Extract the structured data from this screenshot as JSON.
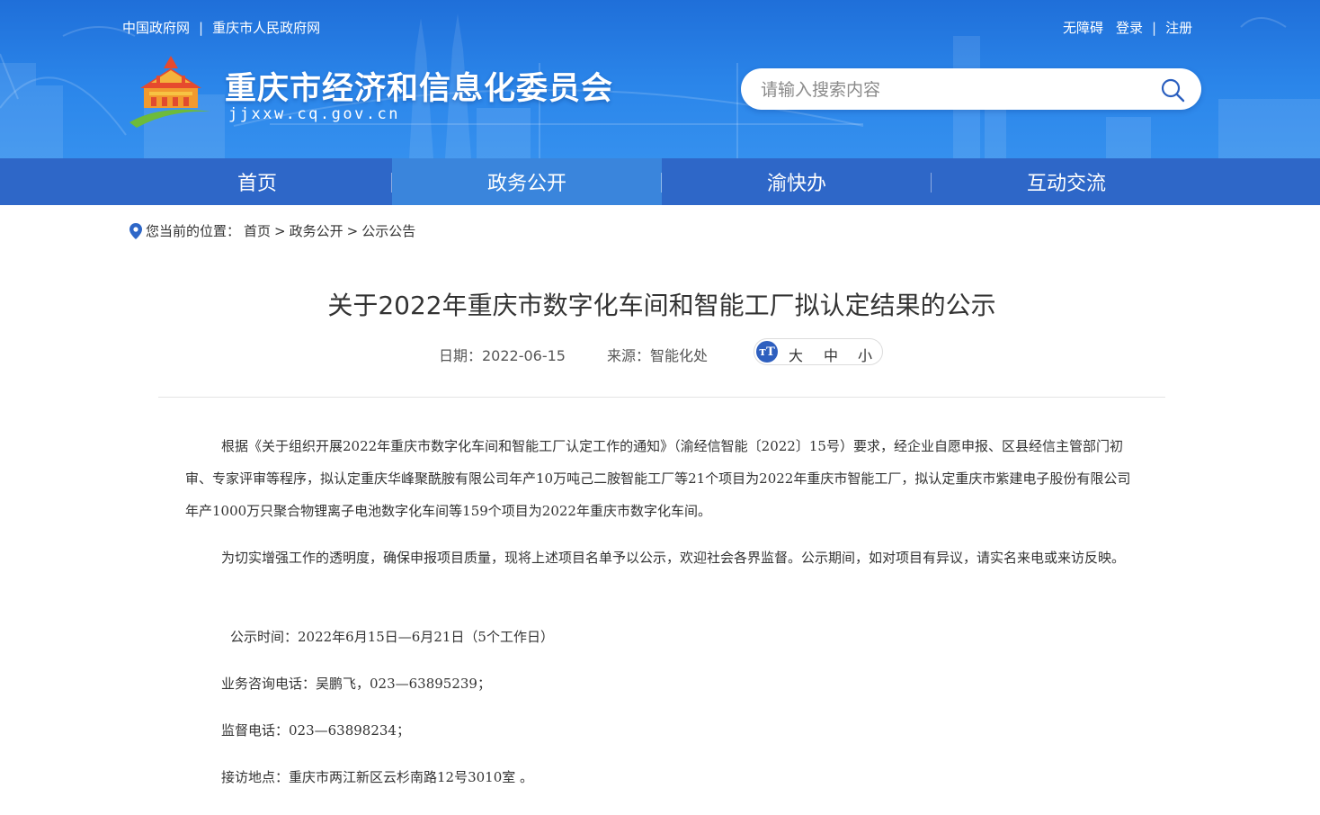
{
  "top_links_left": [
    "中国政府网",
    "重庆市人民政府网"
  ],
  "top_links_right": [
    "无障碍",
    "登录",
    "注册"
  ],
  "site": {
    "title": "重庆市经济和信息化委员会",
    "domain": "jjxxw.cq.gov.cn"
  },
  "search": {
    "placeholder": "请输入搜索内容"
  },
  "nav": [
    "首页",
    "政务公开",
    "渝快办",
    "互动交流"
  ],
  "breadcrumb": {
    "label": "您当前的位置：",
    "items": [
      "首页",
      "政务公开",
      "公示公告"
    ],
    "separator": ">"
  },
  "article": {
    "title": "关于2022年重庆市数字化车间和智能工厂拟认定结果的公示",
    "date": "日期：2022-06-15",
    "source": "来源：智能化处",
    "font_size_options": [
      "大",
      "中",
      "小"
    ],
    "paragraphs": [
      "根据《关于组织开展2022年重庆市数字化车间和智能工厂认定工作的通知》（渝经信智能〔2022〕15号）要求，经企业自愿申报、区县经信主管部门初审、专家评审等程序，拟认定重庆华峰聚酰胺有限公司年产10万吨己二胺智能工厂等21个项目为2022年重庆市智能工厂，拟认定重庆市紫建电子股份有限公司年产1000万只聚合物锂离子电池数字化车间等159个项目为2022年重庆市数字化车间。",
      "为切实增强工作的透明度，确保申报项目质量，现将上述项目名单予以公示，欢迎社会各界监督。公示期间，如对项目有异议，请实名来电或来访反映。",
      "公示时间：2022年6月15日—6月21日（5个工作日）",
      "业务咨询电话：吴鹏飞，023—63895239；",
      "监督电话：023—63898234；",
      "接访地点：重庆市两江新区云杉南路12号3010室 。"
    ]
  },
  "colors": {
    "header_blue": "#2b86ea",
    "nav_blue": "#2e67c8",
    "nav_active": "#3a85dc",
    "font_icon": "#2e5fbf"
  },
  "icons": [
    "location-pin-icon",
    "search-icon",
    "font-size-icon",
    "site-logo"
  ]
}
